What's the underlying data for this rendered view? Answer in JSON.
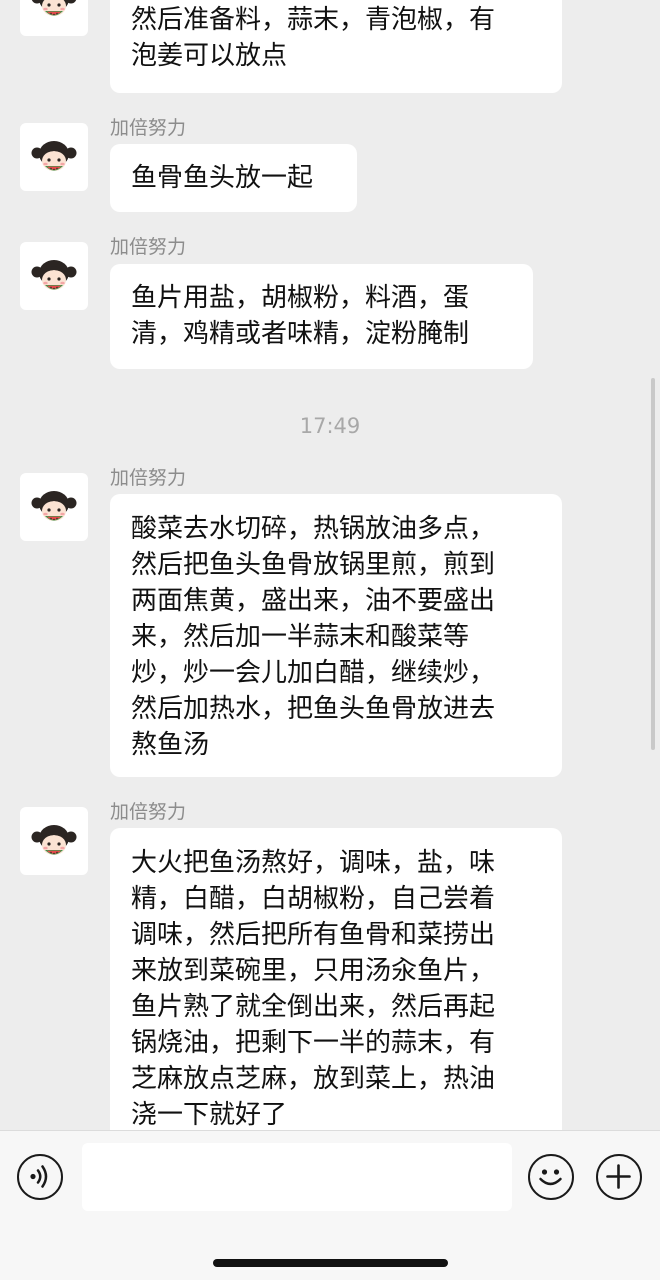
{
  "messages": [
    {
      "sender": "",
      "text": "然后准备料，蒜末，青泡椒，有\n泡姜可以放点"
    },
    {
      "sender": "加倍努力",
      "text": "鱼骨鱼头放一起"
    },
    {
      "sender": "加倍努力",
      "text": "鱼片用盐，胡椒粉，料酒，蛋\n清，鸡精或者味精，淀粉腌制"
    },
    {
      "sender": "加倍努力",
      "text": "酸菜去水切碎，热锅放油多点，\n然后把鱼头鱼骨放锅里煎，煎到\n两面焦黄，盛出来，油不要盛出\n来，然后加一半蒜末和酸菜等\n炒，炒一会儿加白醋，继续炒，\n然后加热水，把鱼头鱼骨放进去\n熬鱼汤"
    },
    {
      "sender": "加倍努力",
      "text": "大火把鱼汤熬好，调味，盐，味\n精，白醋，白胡椒粉，自己尝着\n调味，然后把所有鱼骨和菜捞出\n来放到菜碗里，只用汤汆鱼片，\n鱼片熟了就全倒出来，然后再起\n锅烧油，把剩下一半的蒜末，有\n芝麻放点芝麻，放到菜上，热油\n浇一下就好了"
    }
  ],
  "timestamp": "17:49",
  "composer": {
    "voice_icon": "voice-icon",
    "emoji_icon": "emoji-icon",
    "add_icon": "plus-icon",
    "input_value": ""
  },
  "colors": {
    "background": "#ededed",
    "bubble": "#ffffff",
    "sender_name": "#8c8c8c",
    "timestamp": "#a8a8a8"
  }
}
